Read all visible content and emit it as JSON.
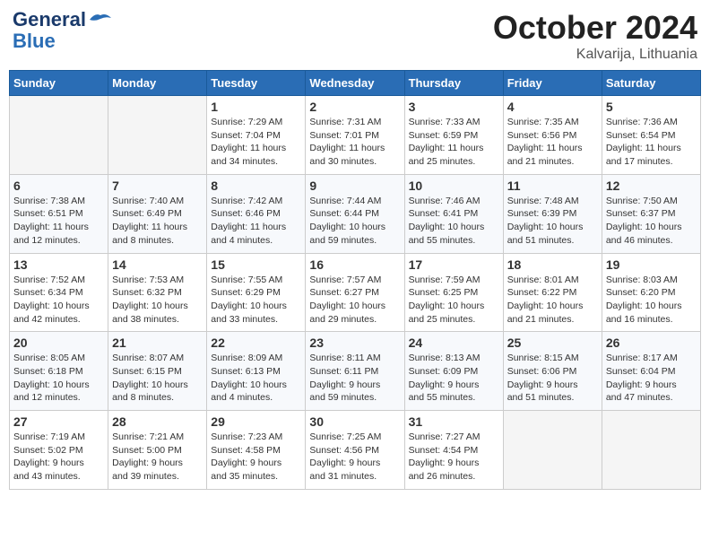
{
  "header": {
    "logo_line1": "General",
    "logo_line2": "Blue",
    "month": "October 2024",
    "location": "Kalvarija, Lithuania"
  },
  "weekdays": [
    "Sunday",
    "Monday",
    "Tuesday",
    "Wednesday",
    "Thursday",
    "Friday",
    "Saturday"
  ],
  "weeks": [
    [
      {
        "day": "",
        "info": ""
      },
      {
        "day": "",
        "info": ""
      },
      {
        "day": "1",
        "info": "Sunrise: 7:29 AM\nSunset: 7:04 PM\nDaylight: 11 hours\nand 34 minutes."
      },
      {
        "day": "2",
        "info": "Sunrise: 7:31 AM\nSunset: 7:01 PM\nDaylight: 11 hours\nand 30 minutes."
      },
      {
        "day": "3",
        "info": "Sunrise: 7:33 AM\nSunset: 6:59 PM\nDaylight: 11 hours\nand 25 minutes."
      },
      {
        "day": "4",
        "info": "Sunrise: 7:35 AM\nSunset: 6:56 PM\nDaylight: 11 hours\nand 21 minutes."
      },
      {
        "day": "5",
        "info": "Sunrise: 7:36 AM\nSunset: 6:54 PM\nDaylight: 11 hours\nand 17 minutes."
      }
    ],
    [
      {
        "day": "6",
        "info": "Sunrise: 7:38 AM\nSunset: 6:51 PM\nDaylight: 11 hours\nand 12 minutes."
      },
      {
        "day": "7",
        "info": "Sunrise: 7:40 AM\nSunset: 6:49 PM\nDaylight: 11 hours\nand 8 minutes."
      },
      {
        "day": "8",
        "info": "Sunrise: 7:42 AM\nSunset: 6:46 PM\nDaylight: 11 hours\nand 4 minutes."
      },
      {
        "day": "9",
        "info": "Sunrise: 7:44 AM\nSunset: 6:44 PM\nDaylight: 10 hours\nand 59 minutes."
      },
      {
        "day": "10",
        "info": "Sunrise: 7:46 AM\nSunset: 6:41 PM\nDaylight: 10 hours\nand 55 minutes."
      },
      {
        "day": "11",
        "info": "Sunrise: 7:48 AM\nSunset: 6:39 PM\nDaylight: 10 hours\nand 51 minutes."
      },
      {
        "day": "12",
        "info": "Sunrise: 7:50 AM\nSunset: 6:37 PM\nDaylight: 10 hours\nand 46 minutes."
      }
    ],
    [
      {
        "day": "13",
        "info": "Sunrise: 7:52 AM\nSunset: 6:34 PM\nDaylight: 10 hours\nand 42 minutes."
      },
      {
        "day": "14",
        "info": "Sunrise: 7:53 AM\nSunset: 6:32 PM\nDaylight: 10 hours\nand 38 minutes."
      },
      {
        "day": "15",
        "info": "Sunrise: 7:55 AM\nSunset: 6:29 PM\nDaylight: 10 hours\nand 33 minutes."
      },
      {
        "day": "16",
        "info": "Sunrise: 7:57 AM\nSunset: 6:27 PM\nDaylight: 10 hours\nand 29 minutes."
      },
      {
        "day": "17",
        "info": "Sunrise: 7:59 AM\nSunset: 6:25 PM\nDaylight: 10 hours\nand 25 minutes."
      },
      {
        "day": "18",
        "info": "Sunrise: 8:01 AM\nSunset: 6:22 PM\nDaylight: 10 hours\nand 21 minutes."
      },
      {
        "day": "19",
        "info": "Sunrise: 8:03 AM\nSunset: 6:20 PM\nDaylight: 10 hours\nand 16 minutes."
      }
    ],
    [
      {
        "day": "20",
        "info": "Sunrise: 8:05 AM\nSunset: 6:18 PM\nDaylight: 10 hours\nand 12 minutes."
      },
      {
        "day": "21",
        "info": "Sunrise: 8:07 AM\nSunset: 6:15 PM\nDaylight: 10 hours\nand 8 minutes."
      },
      {
        "day": "22",
        "info": "Sunrise: 8:09 AM\nSunset: 6:13 PM\nDaylight: 10 hours\nand 4 minutes."
      },
      {
        "day": "23",
        "info": "Sunrise: 8:11 AM\nSunset: 6:11 PM\nDaylight: 9 hours\nand 59 minutes."
      },
      {
        "day": "24",
        "info": "Sunrise: 8:13 AM\nSunset: 6:09 PM\nDaylight: 9 hours\nand 55 minutes."
      },
      {
        "day": "25",
        "info": "Sunrise: 8:15 AM\nSunset: 6:06 PM\nDaylight: 9 hours\nand 51 minutes."
      },
      {
        "day": "26",
        "info": "Sunrise: 8:17 AM\nSunset: 6:04 PM\nDaylight: 9 hours\nand 47 minutes."
      }
    ],
    [
      {
        "day": "27",
        "info": "Sunrise: 7:19 AM\nSunset: 5:02 PM\nDaylight: 9 hours\nand 43 minutes."
      },
      {
        "day": "28",
        "info": "Sunrise: 7:21 AM\nSunset: 5:00 PM\nDaylight: 9 hours\nand 39 minutes."
      },
      {
        "day": "29",
        "info": "Sunrise: 7:23 AM\nSunset: 4:58 PM\nDaylight: 9 hours\nand 35 minutes."
      },
      {
        "day": "30",
        "info": "Sunrise: 7:25 AM\nSunset: 4:56 PM\nDaylight: 9 hours\nand 31 minutes."
      },
      {
        "day": "31",
        "info": "Sunrise: 7:27 AM\nSunset: 4:54 PM\nDaylight: 9 hours\nand 26 minutes."
      },
      {
        "day": "",
        "info": ""
      },
      {
        "day": "",
        "info": ""
      }
    ]
  ]
}
